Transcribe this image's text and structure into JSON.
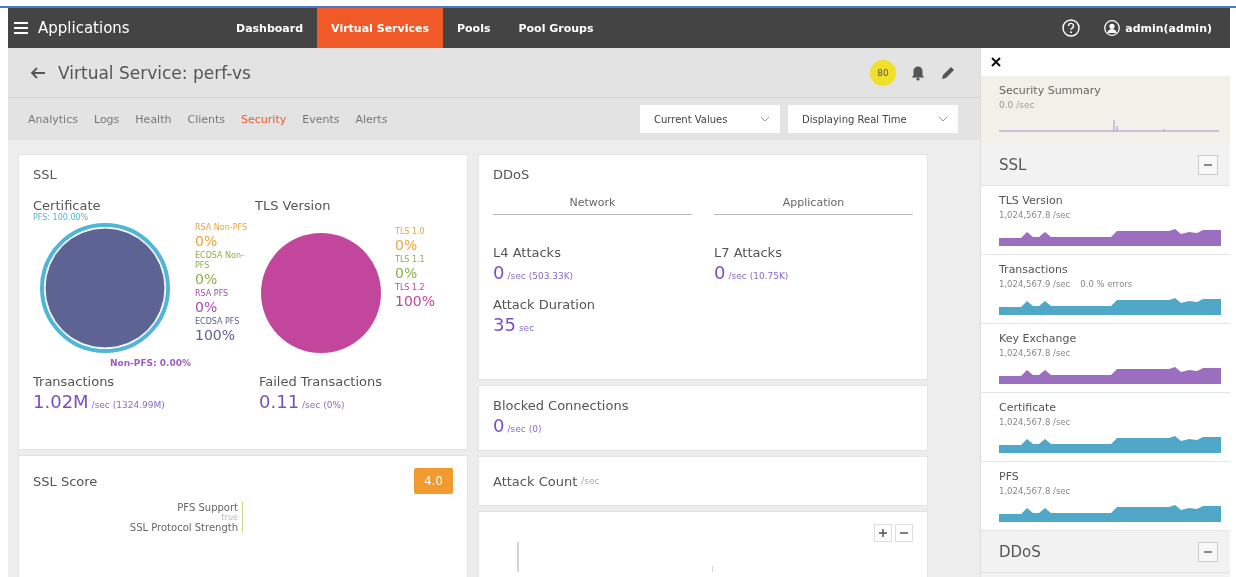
{
  "topbar": {
    "title": "Applications",
    "nav": [
      {
        "label": "Dashboard",
        "selected": false
      },
      {
        "label": "Virtual Services",
        "selected": true
      },
      {
        "label": "Pools",
        "selected": false
      },
      {
        "label": "Pool Groups",
        "selected": false
      }
    ],
    "user": "admin(admin)"
  },
  "header": {
    "title": "Virtual Service: perf-vs",
    "badge": "80"
  },
  "subnav": {
    "tabs": [
      {
        "label": "Analytics",
        "selected": false
      },
      {
        "label": "Logs",
        "selected": false
      },
      {
        "label": "Health",
        "selected": false
      },
      {
        "label": "Clients",
        "selected": false
      },
      {
        "label": "Security",
        "selected": true
      },
      {
        "label": "Events",
        "selected": false
      },
      {
        "label": "Alerts",
        "selected": false
      }
    ],
    "dropdowns": [
      "Current Values",
      "Displaying Real Time"
    ]
  },
  "ssl": {
    "title": "SSL",
    "certificate": {
      "title": "Certificate",
      "ring_labels": [
        {
          "text": "PFS: 100.00%",
          "color": "#4fb6d6"
        },
        {
          "text": "Non-PFS: 0.00%",
          "color": "#9b5cc4"
        }
      ],
      "legend": [
        {
          "label": "RSA Non-PFS",
          "value": "0%",
          "color": "#e9a53c"
        },
        {
          "label": "ECDSA Non-PFS",
          "value": "0%",
          "color": "#8bb04c"
        },
        {
          "label": "RSA PFS",
          "value": "0%",
          "color": "#a64bb5"
        },
        {
          "label": "ECDSA PFS",
          "value": "100%",
          "color": "#5d6494"
        }
      ]
    },
    "tls": {
      "title": "TLS Version",
      "legend": [
        {
          "label": "TLS 1.0",
          "value": "0%",
          "color": "#e9a53c"
        },
        {
          "label": "TLS 1.1",
          "value": "0%",
          "color": "#8bb04c"
        },
        {
          "label": "TLS 1.2",
          "value": "100%",
          "color": "#c2479c"
        }
      ]
    },
    "stats": [
      {
        "label": "Transactions",
        "value": "1.02M",
        "unit": "/sec",
        "extra": "(1324.99M)"
      },
      {
        "label": "Failed Transactions",
        "value": "0.11",
        "unit": "/sec",
        "extra": "(0%)"
      }
    ]
  },
  "ssl_score": {
    "title": "SSL Score",
    "score": "4.0",
    "rows": [
      {
        "label": "PFS Support",
        "value": "true"
      },
      {
        "label": "SSL Protocol Strength"
      }
    ]
  },
  "ddos": {
    "title": "DDoS",
    "columns": [
      "Network",
      "Application"
    ],
    "stats": [
      {
        "label": "L4 Attacks",
        "value": "0",
        "unit": "/sec",
        "extra": "(503.33K)"
      },
      {
        "label": "L7 Attacks",
        "value": "0",
        "unit": "/sec",
        "extra": "(10.75K)"
      },
      {
        "label": "Attack Duration",
        "value": "35",
        "unit": "sec"
      }
    ]
  },
  "blocked": {
    "label": "Blocked Connections",
    "value": "0",
    "unit": "/sec",
    "extra": "(0)"
  },
  "attack_count": {
    "title": "Attack Count",
    "unit": "/sec"
  },
  "sidebar": {
    "summary": {
      "title": "Security Summary",
      "value": "0.0 /sec"
    },
    "sections": [
      {
        "title": "SSL",
        "expanded": true,
        "items": [
          {
            "title": "TLS Version",
            "value": "1,024,567.8 /sec",
            "color": "#9b6ec0"
          },
          {
            "title": "Transactions",
            "value": "1,024,567.9 /sec",
            "errors": "0.0 % errors",
            "color": "#4fa8c8"
          },
          {
            "title": "Key Exchange",
            "value": "1,024,567.8 /sec",
            "color": "#9b6ec0"
          },
          {
            "title": "Certificate",
            "value": "1,024,567.8 /sec",
            "color": "#4fa8c8"
          },
          {
            "title": "PFS",
            "value": "1,024,567.8 /sec",
            "color": "#4fa8c8"
          }
        ]
      },
      {
        "title": "DDoS",
        "expanded": true
      }
    ]
  }
}
